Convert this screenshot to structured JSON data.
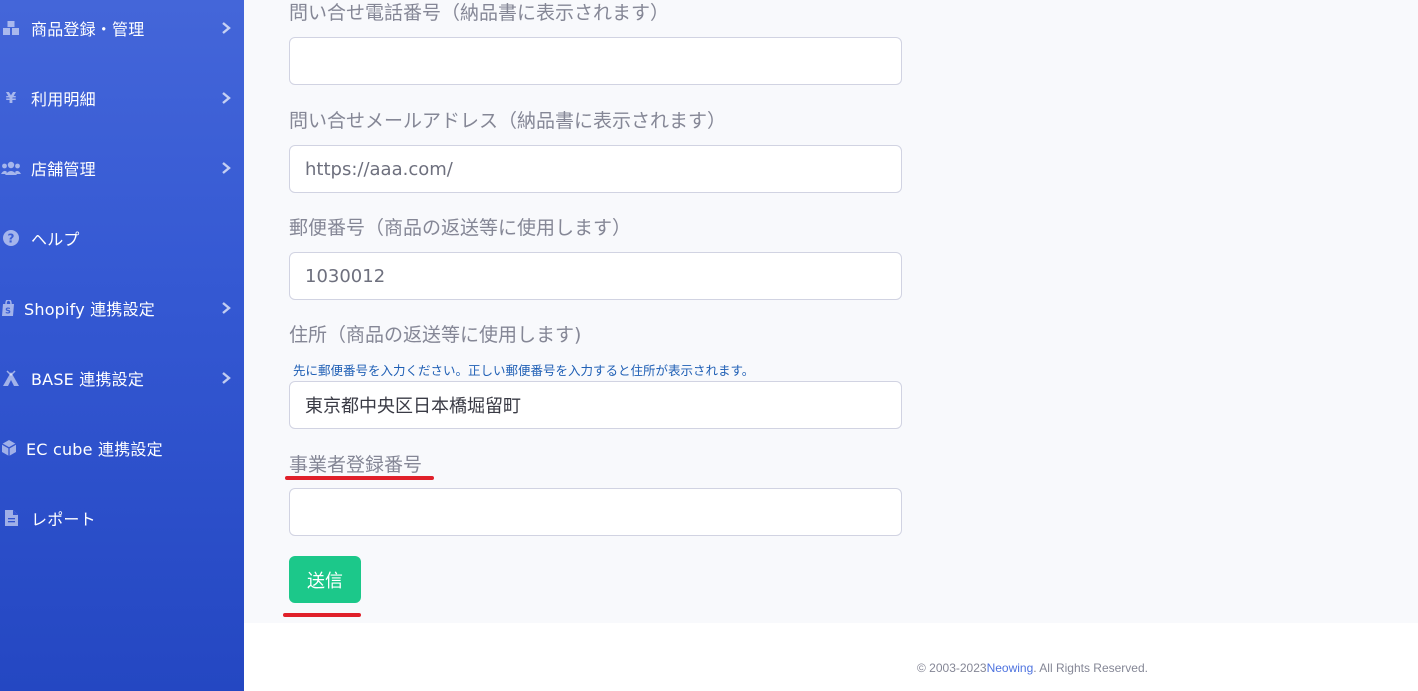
{
  "sidebar": {
    "items": [
      {
        "label": "商品登録・管理",
        "icon": "boxes-icon",
        "has_chevron": true
      },
      {
        "label": "利用明細",
        "icon": "yen-icon",
        "has_chevron": true
      },
      {
        "label": "店舗管理",
        "icon": "users-icon",
        "has_chevron": true
      },
      {
        "label": "ヘルプ",
        "icon": "question-circle-icon",
        "has_chevron": false
      },
      {
        "label": "Shopify 連携設定",
        "icon": "shopify-bag-icon",
        "has_chevron": true
      },
      {
        "label": "BASE 連携設定",
        "icon": "campground-icon",
        "has_chevron": true
      },
      {
        "label": "EC cube 連携設定",
        "icon": "cube-icon",
        "has_chevron": false
      },
      {
        "label": "レポート",
        "icon": "file-icon",
        "has_chevron": false
      }
    ]
  },
  "form": {
    "phone": {
      "label": "問い合せ電話番号（納品書に表示されます）",
      "value": ""
    },
    "email": {
      "label": "問い合せメールアドレス（納品書に表示されます）",
      "value": "https://aaa.com/"
    },
    "postal": {
      "label": "郵便番号（商品の返送等に使用します）",
      "value": "1030012"
    },
    "address": {
      "label": "住所（商品の返送等に使用します)",
      "hint": "先に郵便番号を入力ください。正しい郵便番号を入力すると住所が表示されます。",
      "value": "東京都中央区日本橋堀留町"
    },
    "business_number": {
      "label": "事業者登録番号",
      "value": ""
    },
    "submit_label": "送信"
  },
  "footer": {
    "copyright_prefix": "© 2003-2023",
    "brand": "Neowing",
    "copyright_suffix": ". All Rights Reserved."
  },
  "colors": {
    "sidebar_top": "#4466d9",
    "sidebar_bottom": "#2447c2",
    "submit": "#1cc88a",
    "annotation_underline": "#e0202a",
    "hint_text": "#1f5fb5",
    "brand_link": "#4e73df"
  }
}
